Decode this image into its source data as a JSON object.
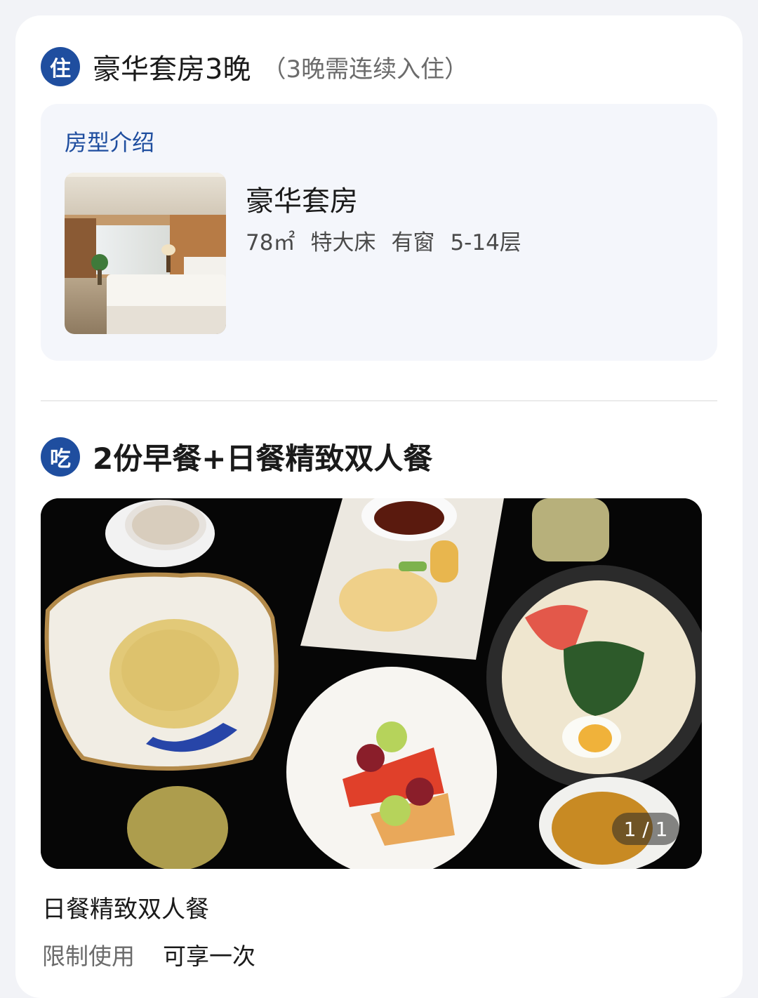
{
  "stay": {
    "badge": "住",
    "title": "豪华套房3晚",
    "note": "（3晚需连续入住）",
    "room_intro": {
      "section_title": "房型介绍",
      "room_name": "豪华套房",
      "area": "78㎡",
      "bed": "特大床",
      "window": "有窗",
      "floors": "5-14层"
    }
  },
  "eat": {
    "badge": "吃",
    "title": "2份早餐+日餐精致双人餐",
    "photo_pager": "1 / 1",
    "meal_name": "日餐精致双人餐",
    "usage_label": "限制使用",
    "usage_value": "可享一次"
  },
  "colors": {
    "brand_blue": "#1f4e9f",
    "card_bg": "#ffffff",
    "box_bg": "#f4f6fb"
  }
}
